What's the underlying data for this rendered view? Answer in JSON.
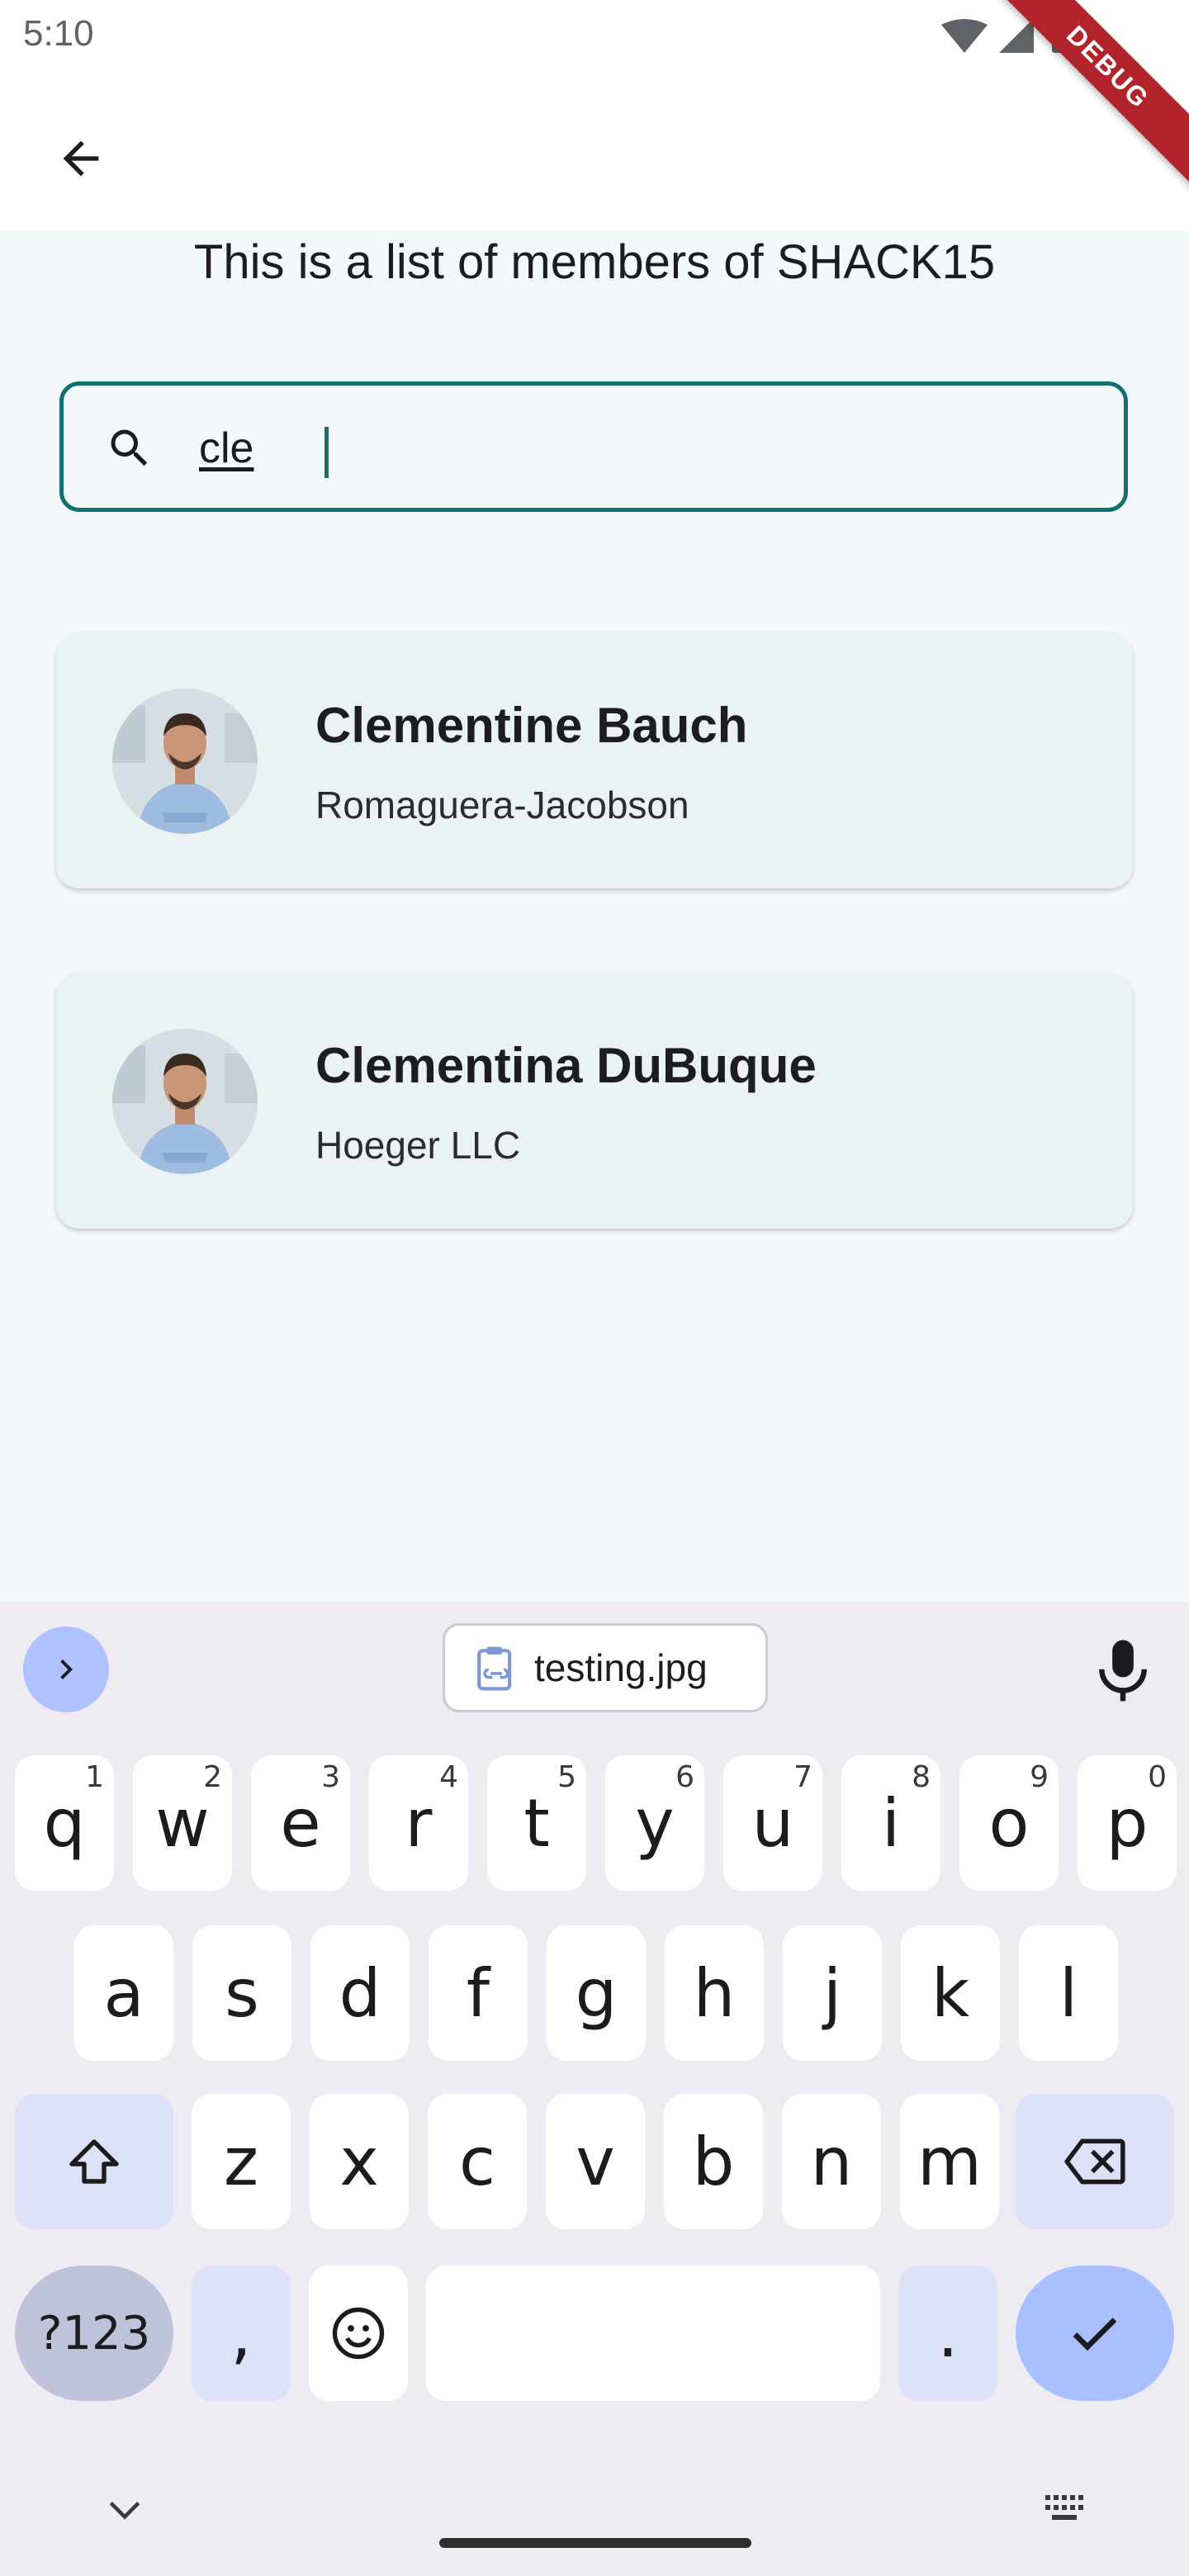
{
  "status_bar": {
    "time": "5:10",
    "debug_label": "DEBUG"
  },
  "page": {
    "title": "This is a list of members of SHACK15"
  },
  "search": {
    "value": "cle"
  },
  "members": [
    {
      "name": "Clementine Bauch",
      "company": "Romaguera-Jacobson"
    },
    {
      "name": "Clementina DuBuque",
      "company": "Hoeger LLC"
    }
  ],
  "keyboard": {
    "clipboard_item": "testing.jpg",
    "row1": [
      {
        "key": "q",
        "hint": "1"
      },
      {
        "key": "w",
        "hint": "2"
      },
      {
        "key": "e",
        "hint": "3"
      },
      {
        "key": "r",
        "hint": "4"
      },
      {
        "key": "t",
        "hint": "5"
      },
      {
        "key": "y",
        "hint": "6"
      },
      {
        "key": "u",
        "hint": "7"
      },
      {
        "key": "i",
        "hint": "8"
      },
      {
        "key": "o",
        "hint": "9"
      },
      {
        "key": "p",
        "hint": "0"
      }
    ],
    "row2": [
      "a",
      "s",
      "d",
      "f",
      "g",
      "h",
      "j",
      "k",
      "l"
    ],
    "row3": [
      "z",
      "x",
      "c",
      "v",
      "b",
      "n",
      "m"
    ],
    "symbols_label": "?123",
    "comma": ",",
    "period": "."
  },
  "colors": {
    "accent": "#136F72",
    "card": "#EAF2F4",
    "background": "#F3F9FB",
    "keyboard": "#EFEBF3"
  }
}
